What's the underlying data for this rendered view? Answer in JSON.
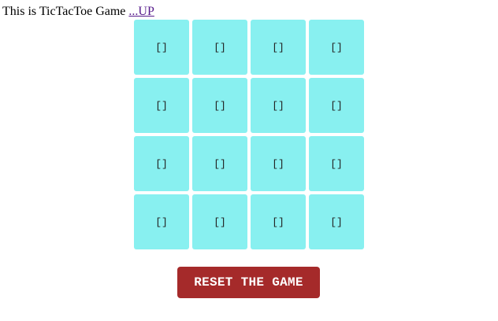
{
  "header": {
    "text": "This is TicTacToe Game ",
    "link_label": "...UP"
  },
  "board": {
    "rows": 4,
    "columns": 4,
    "cells": [
      "[]",
      "[]",
      "[]",
      "[]",
      "[]",
      "[]",
      "[]",
      "[]",
      "[]",
      "[]",
      "[]",
      "[]",
      "[]",
      "[]",
      "[]",
      "[]"
    ],
    "cell_color": "#88f0f0"
  },
  "reset": {
    "label": "RESET THE GAME",
    "color": "#a52a2a"
  }
}
